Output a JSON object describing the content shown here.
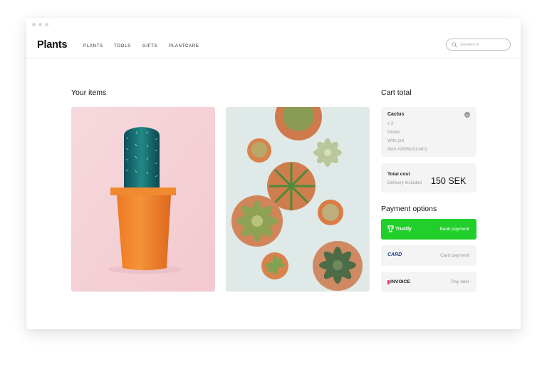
{
  "app": {
    "logo": "Plants"
  },
  "nav": {
    "items": [
      "PLANTS",
      "TOOLS",
      "GIFTS",
      "PLANTCARE"
    ]
  },
  "search": {
    "placeholder": "SEARCH"
  },
  "main": {
    "items_title": "Your items"
  },
  "cart": {
    "title": "Cart total",
    "item": {
      "name": "Cactus",
      "details": [
        "x 2",
        "Green",
        "With pot",
        "Item #2839u512401"
      ]
    },
    "total_label": "Total cost",
    "delivery_note": "Delivery included",
    "total_amount": "150 SEK"
  },
  "payment": {
    "title": "Payment options",
    "options": [
      {
        "brand": "Trustly",
        "label": "Bank payment"
      },
      {
        "brand": "CARD",
        "label": "Card payment"
      },
      {
        "brand": "INVOICE",
        "label": "Pay later"
      }
    ]
  },
  "colors": {
    "accent_green": "#20cf2a",
    "card_blue": "#1d3f8f",
    "invoice_pink": "#e8306a",
    "panel_bg": "#f4f4f4"
  }
}
